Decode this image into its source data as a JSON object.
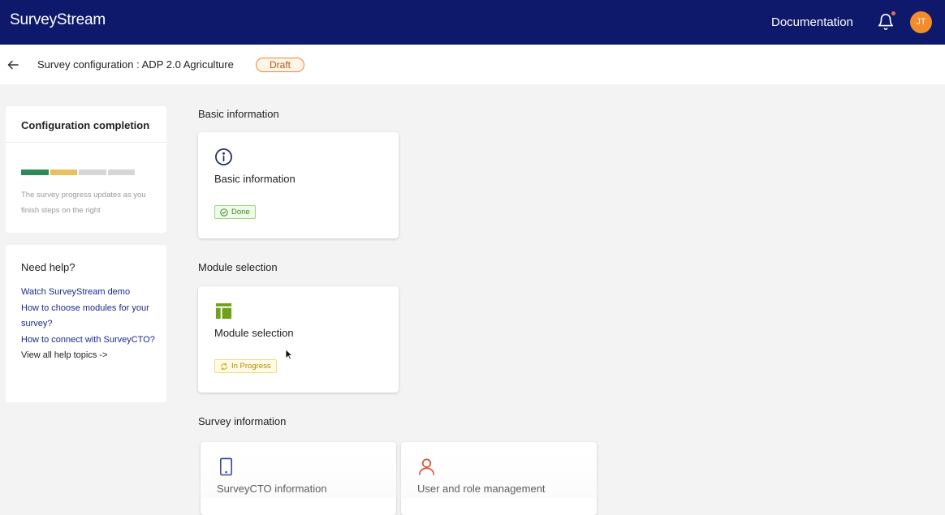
{
  "header": {
    "brand": "SurveyStream",
    "documentation_label": "Documentation",
    "avatar_initials": "JT",
    "bg_color": "#0e196b"
  },
  "subheader": {
    "title": "Survey configuration : ADP 2.0 Agriculture",
    "status_badge": "Draft"
  },
  "sidebar": {
    "configuration": {
      "title": "Configuration completion",
      "progress_segments": [
        {
          "color": "#2e8b57",
          "state": "done"
        },
        {
          "color": "#e8c060",
          "state": "in-progress"
        },
        {
          "color": "#d6d6d6",
          "state": "todo"
        },
        {
          "color": "#d6d6d6",
          "state": "todo"
        }
      ],
      "note": "The survey progress updates as you finish steps on the right"
    },
    "help": {
      "title": "Need help?",
      "links": [
        {
          "label": "Watch SurveyStream demo"
        },
        {
          "label": "How to choose modules for your survey?"
        },
        {
          "label": "How to connect with SurveyCTO?"
        },
        {
          "label": "View all help topics ->"
        }
      ]
    }
  },
  "sections": [
    {
      "heading": "Basic information",
      "cards": [
        {
          "title": "Basic information",
          "icon": "info-icon",
          "status": "Done"
        }
      ]
    },
    {
      "heading": "Module selection",
      "cards": [
        {
          "title": "Module selection",
          "icon": "layout-icon",
          "status": "In Progress"
        }
      ]
    },
    {
      "heading": "Survey information",
      "cards": [
        {
          "title": "SurveyCTO information",
          "icon": "tablet-icon"
        },
        {
          "title": "User and role management",
          "icon": "user-icon"
        }
      ]
    }
  ]
}
